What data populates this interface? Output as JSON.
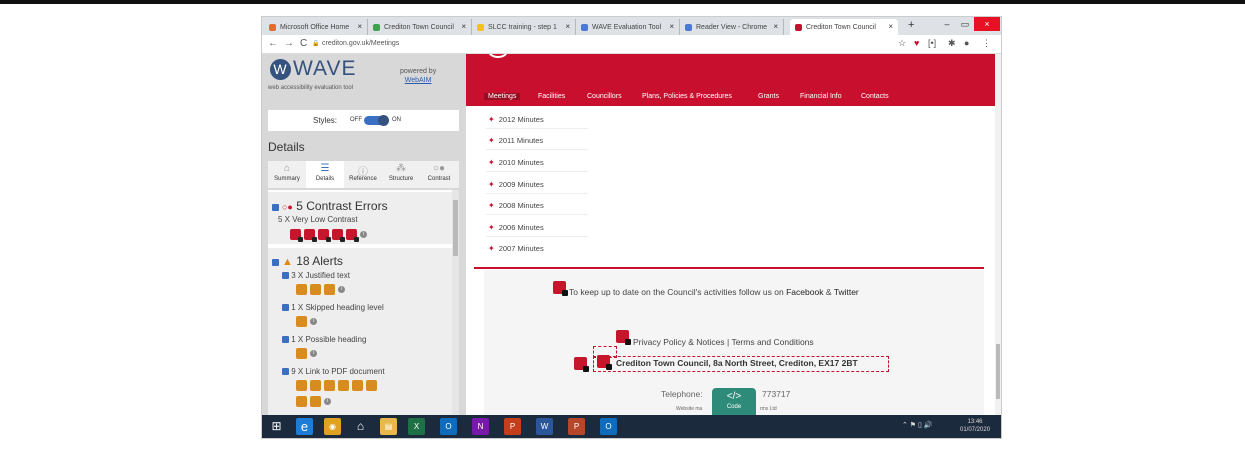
{
  "browser": {
    "tabs": [
      {
        "label": "Microsoft Office Home",
        "color": "#e86a2c"
      },
      {
        "label": "Crediton Town Council",
        "color": "#3fa34d"
      },
      {
        "label": "SLCC training - step 1",
        "color": "#f0c419"
      },
      {
        "label": "WAVE Evaluation Tool",
        "color": "#4a7bd0"
      },
      {
        "label": "Reader View - Chrome",
        "color": "#4a7bd0"
      },
      {
        "label": "Crediton Town Council",
        "color": "#c8102e"
      }
    ],
    "close_glyph": "×",
    "new_tab": "+",
    "minimize": "–",
    "restore": "▭",
    "close_window": "×",
    "back": "←",
    "forward": "→",
    "reload": "C",
    "lock": "🔒",
    "url": "crediton.gov.uk/Meetings",
    "right_icons": [
      "☆",
      "♥",
      "[•]",
      "✱",
      "●",
      "⋮"
    ]
  },
  "wave": {
    "logo_w": "W",
    "logo_text": "WAVE",
    "subtitle": "web accessibility evaluation tool",
    "powered_by": "powered by",
    "powered_link": "WebAIM",
    "styles_label": "Styles:",
    "styles_off": "OFF",
    "styles_on": "ON",
    "details_title": "Details",
    "tabs": [
      {
        "icon": "⌂",
        "label": "Summary"
      },
      {
        "icon": "☰",
        "label": "Details"
      },
      {
        "icon": "ⓘ",
        "label": "Reference"
      },
      {
        "icon": "⁂",
        "label": "Structure"
      },
      {
        "icon": "○●",
        "label": "Contrast"
      }
    ],
    "contrast": {
      "title": "5 Contrast Errors",
      "prefix": "○●",
      "line": "5 X Very Low Contrast"
    },
    "alerts": {
      "title": "18 Alerts",
      "prefix": "▲",
      "items": [
        "3 X Justified text",
        "1 X Skipped heading level",
        "1 X Possible heading",
        "9 X Link to PDF document"
      ]
    },
    "info_glyph": "i"
  },
  "site": {
    "menu": [
      "Meetings",
      "Facilities",
      "Councillors",
      "Plans, Policies & Procedures",
      "Grants",
      "Financial Info",
      "Contacts"
    ],
    "minutes": [
      "2012 Minutes",
      "2011 Minutes",
      "2010 Minutes",
      "2009 Minutes",
      "2008 Minutes",
      "2006 Minutes",
      "2007 Minutes"
    ],
    "bullet": "✦",
    "follow_text": "To keep up to date on the Council's activities follow us on",
    "facebook": "Facebook",
    "amp": "&",
    "twitter": "Twitter",
    "privacy": "Privacy Policy & Notices",
    "sep": "|",
    "terms": "Terms and Conditions",
    "address": "Crediton Town Council, 8a North Street, Crediton, EX17 2BT",
    "telephone_label": "Telephone:",
    "telephone_num": "773717",
    "website_left": "Website ma",
    "website_right": "rms Ltd",
    "code_glyph": "</>",
    "code_label": "Code"
  },
  "taskbar": {
    "apps": [
      {
        "icon": "⊞",
        "color": "#1c2a3d"
      },
      {
        "icon": "e",
        "color": "#1c7cd6"
      },
      {
        "icon": "◉",
        "color": "#e0a020"
      },
      {
        "icon": "⌂",
        "color": "#1c2a3d"
      },
      {
        "icon": "▤",
        "color": "#e8b84a"
      },
      {
        "icon": "X",
        "color": "#1e7145"
      },
      {
        "icon": "O",
        "color": "#0f6cbd"
      },
      {
        "icon": "N",
        "color": "#7719aa"
      },
      {
        "icon": "P",
        "color": "#c43e1c"
      },
      {
        "icon": "W",
        "color": "#2b579a"
      },
      {
        "icon": "P",
        "color": "#b7472a"
      },
      {
        "icon": "O",
        "color": "#0f6cbd"
      }
    ],
    "tray_icons": "⌃ ⚑ ▯ 🔊",
    "time": "13:46",
    "date": "01/07/2020"
  }
}
